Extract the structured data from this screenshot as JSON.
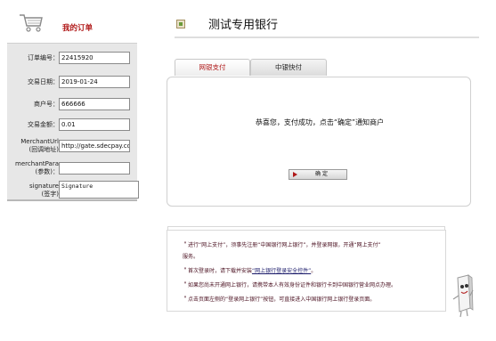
{
  "sidebar": {
    "title": "我的订单"
  },
  "form": {
    "fields": [
      {
        "label": "订单编号：",
        "value": "22415920"
      },
      {
        "label": "交易日期：",
        "value": "2019-01-24"
      },
      {
        "label": "商户号：",
        "value": "666666"
      },
      {
        "label": "交易金额：",
        "value": "0.01"
      },
      {
        "label1": "MerchantUrl",
        "label2": "(回调地址)",
        "value": "http://gate.sdecpay.co"
      },
      {
        "label1": "merchantPara",
        "label2": "(参数)：",
        "value": ""
      },
      {
        "label1": "signature",
        "label2": "(签字)",
        "value": "Signature"
      }
    ]
  },
  "bank": {
    "title": "测试专用银行"
  },
  "tabs": [
    {
      "label": "网银支付",
      "active": true
    },
    {
      "label": "中银快付",
      "active": false
    }
  ],
  "result": {
    "message": "恭喜您，支付成功，点击“确定”通知商户",
    "confirm_label": "确  定"
  },
  "notes": {
    "line1": "＂进行“网上支付”，须事先注册“中国银行网上银行”，并登录网银，开通“网上支付”",
    "line1b": "服务。",
    "line2_pre": "＂首次登录时，请下载并安装",
    "line2_link": "“网上银行登录安全控件”",
    "line2_post": "。",
    "line3": "＂如果您尚未开通网上银行，请携带本人有效身份证件和银行卡到中国银行营业网点办理。",
    "line4": "＂点击页面左侧的“登录网上银行”按钮，可直接进入中国银行网上银行登录页面。"
  },
  "colors": {
    "accent_red": "#b01818",
    "panel_gray": "#e7e7e7"
  },
  "icons": [
    "shopping-cart-icon",
    "bank-logo-icon",
    "arrow-right-icon",
    "mascot-icon"
  ]
}
